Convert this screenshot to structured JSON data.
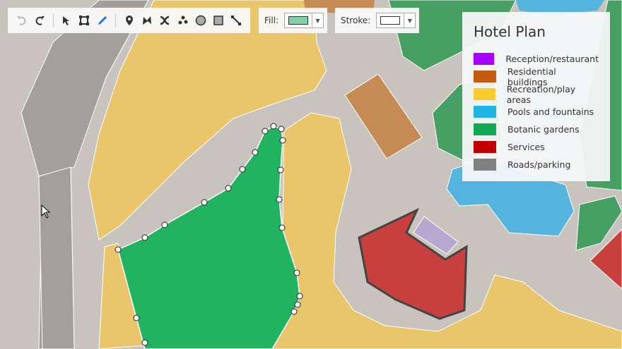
{
  "toolbar": {
    "tools": [
      "undo-icon",
      "redo-icon",
      "select-icon",
      "transform-icon",
      "draw-icon",
      "marker-icon",
      "polyline-icon",
      "split-icon",
      "points-icon",
      "ellipse-icon",
      "rectangle-icon",
      "connector-icon"
    ],
    "fill_label": "Fill:",
    "fill_color": "#7fd3a3",
    "stroke_label": "Stroke:",
    "stroke_color": "#ffffff"
  },
  "legend": {
    "title": "Hotel Plan",
    "items": [
      {
        "label": "Reception/restaurant",
        "color": "#aa00ff"
      },
      {
        "label": "Residential buildings",
        "color": "#c55a11"
      },
      {
        "label": "Recreation/play areas",
        "color": "#fdcb30"
      },
      {
        "label": "Pools and fountains",
        "color": "#1eb4e6"
      },
      {
        "label": "Botanic gardens",
        "color": "#10a957"
      },
      {
        "label": "Services",
        "color": "#c00000"
      },
      {
        "label": "Roads/parking",
        "color": "#808080"
      }
    ]
  }
}
